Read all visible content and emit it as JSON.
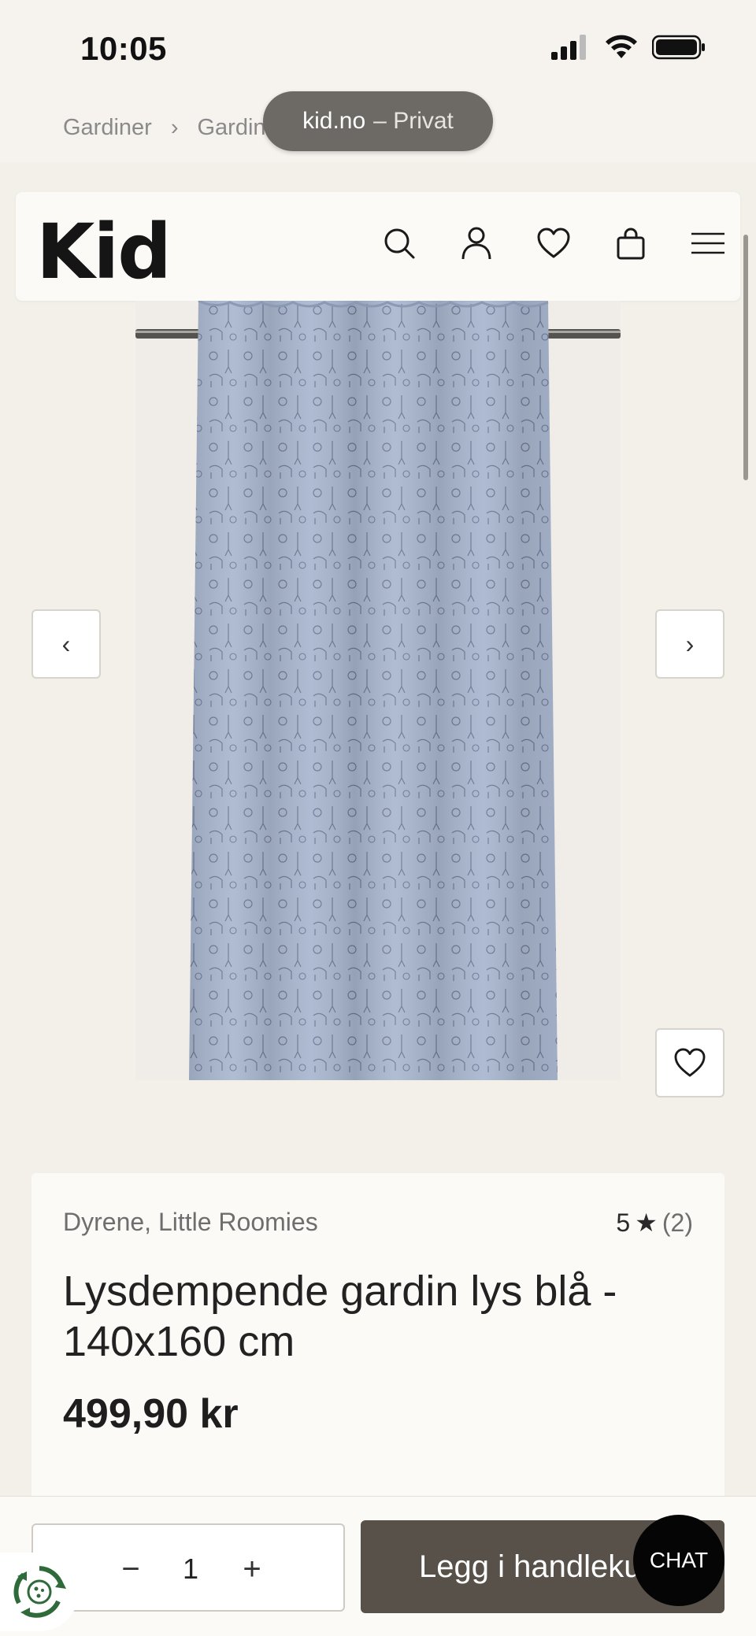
{
  "status": {
    "time": "10:05"
  },
  "breadcrumb": {
    "items": [
      "Gardiner",
      "Gardin"
    ],
    "separator": "›"
  },
  "browser": {
    "domain": "kid.no",
    "mode": "– Privat"
  },
  "header": {
    "logo": "Kid",
    "icons": [
      "search-icon",
      "account-icon",
      "wishlist-icon",
      "cart-icon",
      "menu-icon"
    ]
  },
  "gallery": {
    "prev_glyph": "‹",
    "next_glyph": "›"
  },
  "product": {
    "brand": "Dyrene, Little Roomies",
    "rating_value": "5",
    "rating_star": "★",
    "rating_count": "(2)",
    "title": "Lysdempende gardin lys blå - 140x160 cm",
    "price": "499,90 kr"
  },
  "cart": {
    "minus": "−",
    "quantity": "1",
    "plus": "+",
    "add_label": "Legg i handlekurv"
  },
  "chat": {
    "label": "CHAT"
  },
  "colors": {
    "background": "#f3efe9",
    "card": "#fbfaf7",
    "add_button": "#575149",
    "curtain": "#a9b7cf",
    "chat": "#050505"
  }
}
